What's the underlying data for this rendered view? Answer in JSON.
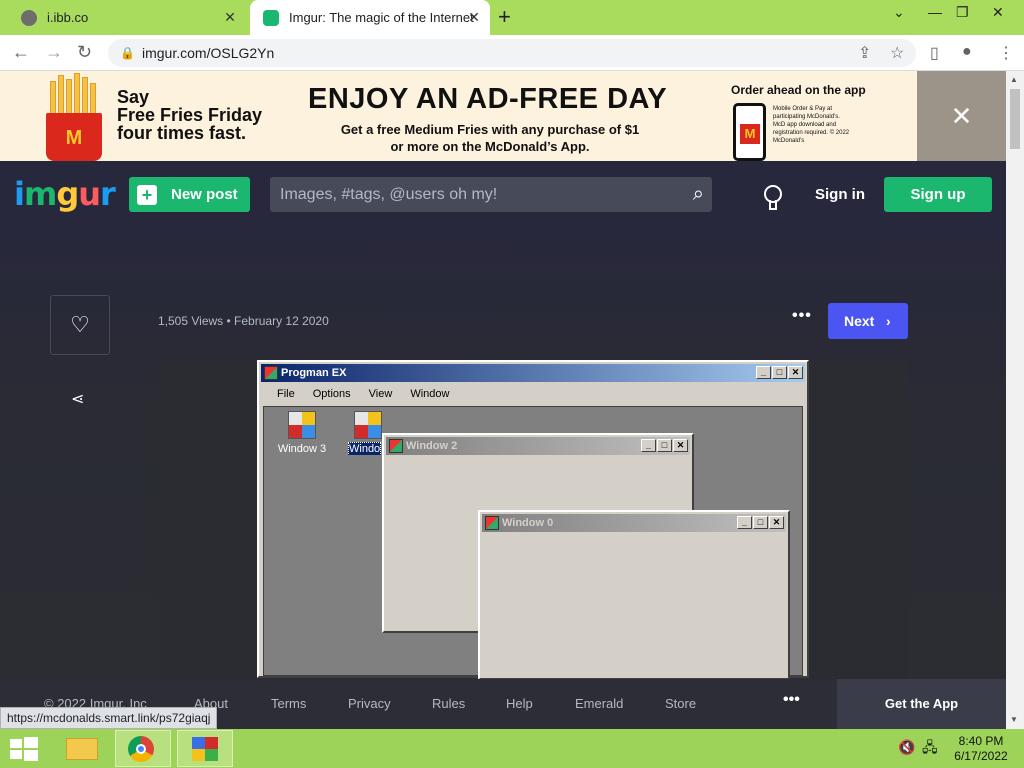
{
  "browser": {
    "tabs": [
      {
        "title": "i.ibb.co",
        "active": false
      },
      {
        "title": "Imgur: The magic of the Internet",
        "active": true
      }
    ],
    "url": "imgur.com/OSLG2Yn",
    "status_url": "https://mcdonalds.smart.link/ps72giaqj"
  },
  "ad": {
    "say_line1": "Say",
    "say_line2": "Free Fries Friday",
    "say_line3": "four times fast.",
    "headline": "ENJOY AN AD-FREE DAY",
    "sub": "Get a free Medium Fries with any purchase of $1 or more on the McDonald’s App.",
    "order": "Order ahead on the app",
    "fine_print": "Mobile Order & Pay at participating McDonald’s. McD app download and registration required. © 2022 McDonald’s",
    "close": "✕",
    "logo_letter": "M"
  },
  "imgur": {
    "logo": [
      "i",
      "m",
      "g",
      "u",
      "r"
    ],
    "new_post": "New post",
    "search_placeholder": "Images, #tags, @users oh my!",
    "sign_in": "Sign in",
    "sign_up": "Sign up"
  },
  "post": {
    "views": "1,505 Views",
    "date": "February 12 2020",
    "next": "Next"
  },
  "screenshot": {
    "main_title": "Progman EX",
    "menu": [
      "File",
      "Options",
      "View",
      "Window"
    ],
    "icons": [
      "Window 3",
      "Windo"
    ],
    "child_windows": [
      "Window 2",
      "Window 0"
    ]
  },
  "footer": {
    "copyright": "© 2022 Imgur, Inc",
    "links": [
      "About",
      "Terms",
      "Privacy",
      "Rules",
      "Help",
      "Emerald",
      "Store"
    ],
    "get_app": "Get the App"
  },
  "taskbar": {
    "time": "8:40 PM",
    "date": "6/17/2022"
  },
  "colors": {
    "imgur_green": "#1bb76e",
    "next_blue": "#4a55f2",
    "taskbar_green": "#9ed35a"
  }
}
